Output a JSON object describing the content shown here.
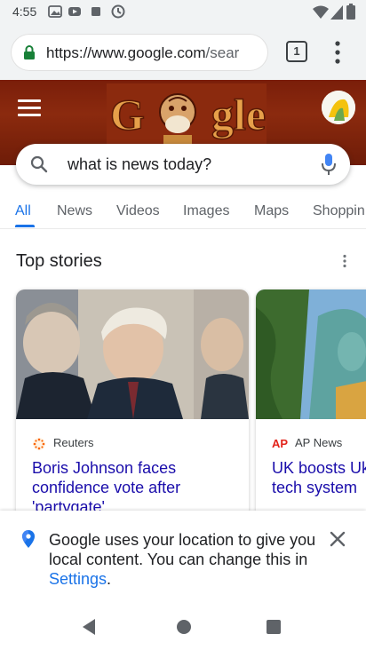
{
  "status_bar": {
    "time": "4:55"
  },
  "browser": {
    "url_host": "https://www.google.com",
    "url_path": "/sear",
    "tab_count": "1"
  },
  "search": {
    "query": "what is news today?"
  },
  "tabs": [
    "All",
    "News",
    "Videos",
    "Images",
    "Maps",
    "Shoppin"
  ],
  "top_stories": {
    "title": "Top stories",
    "cards": [
      {
        "source": "Reuters",
        "headline": "Boris Johnson faces confidence vote after 'partygate'"
      },
      {
        "source": "AP News",
        "headline": "UK boosts Uk with high-tech system"
      }
    ]
  },
  "location_prompt": {
    "text": "Google uses your location to give you local content. You can change this in",
    "link": "Settings",
    "trailing": "."
  },
  "colors": {
    "accent": "#1a73e8",
    "link": "#1a0dab",
    "doodle_bg": "#7a1e0a"
  }
}
